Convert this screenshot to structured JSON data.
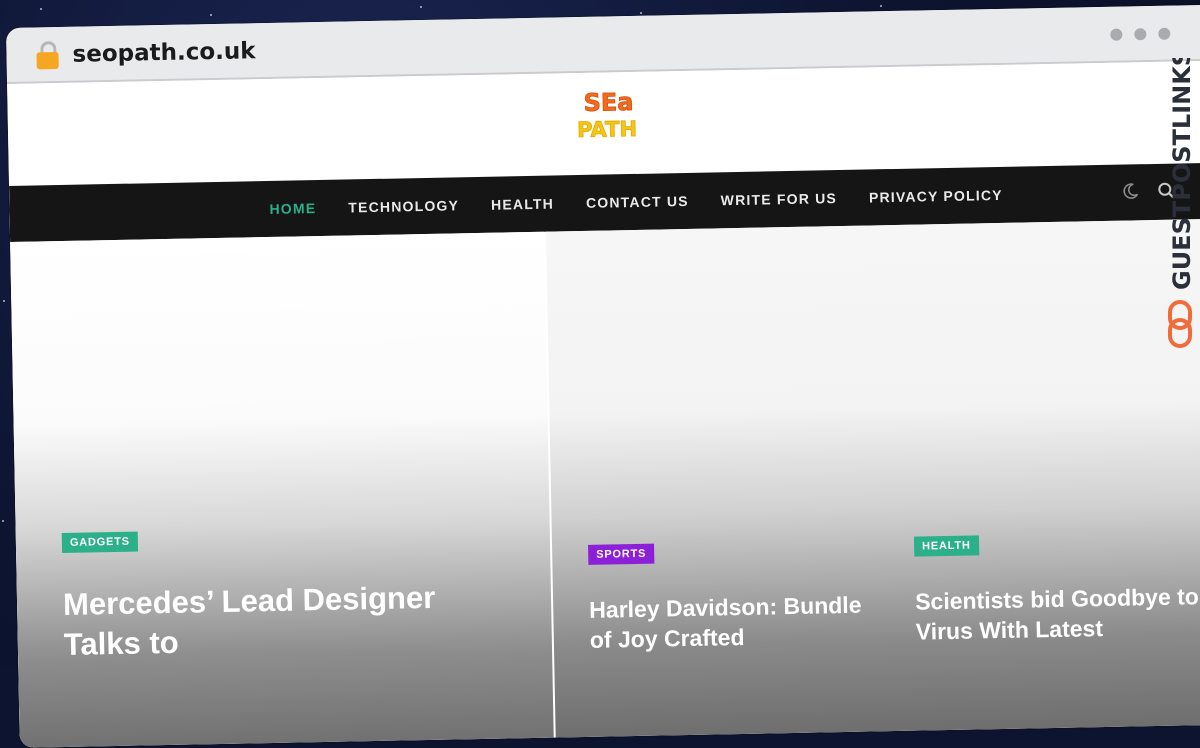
{
  "browser": {
    "url": "seopath.co.uk"
  },
  "site": {
    "logo_line1": "SEa",
    "logo_line2": "PATH",
    "logo_colors": {
      "top": "#f26b1d",
      "bottom": "#f5c518"
    }
  },
  "nav": {
    "items": [
      {
        "label": "HOME",
        "active": true
      },
      {
        "label": "TECHNOLOGY",
        "active": false
      },
      {
        "label": "HEALTH",
        "active": false
      },
      {
        "label": "CONTACT US",
        "active": false
      },
      {
        "label": "WRITE FOR US",
        "active": false
      },
      {
        "label": "PRIVACY POLICY",
        "active": false
      }
    ],
    "icons": [
      "moon-icon",
      "search-icon"
    ],
    "accent": "#2bb08a"
  },
  "posts": [
    {
      "category": "GADGETS",
      "category_color": "#2bb08a",
      "title": "Mercedes’ Lead Designer Talks to"
    },
    {
      "category": "SPORTS",
      "category_color": "#8b20d8",
      "title": "Harley Davidson: Bundle of Joy Crafted"
    },
    {
      "category": "HEALTH",
      "category_color": "#2bb08a",
      "title": "Scientists bid Goodbye to Virus With Latest"
    }
  ],
  "watermark": {
    "text": "GUESTPOSTLINKS",
    "color": "#2b2f3a",
    "link_icon_color": "#f26b3a"
  }
}
